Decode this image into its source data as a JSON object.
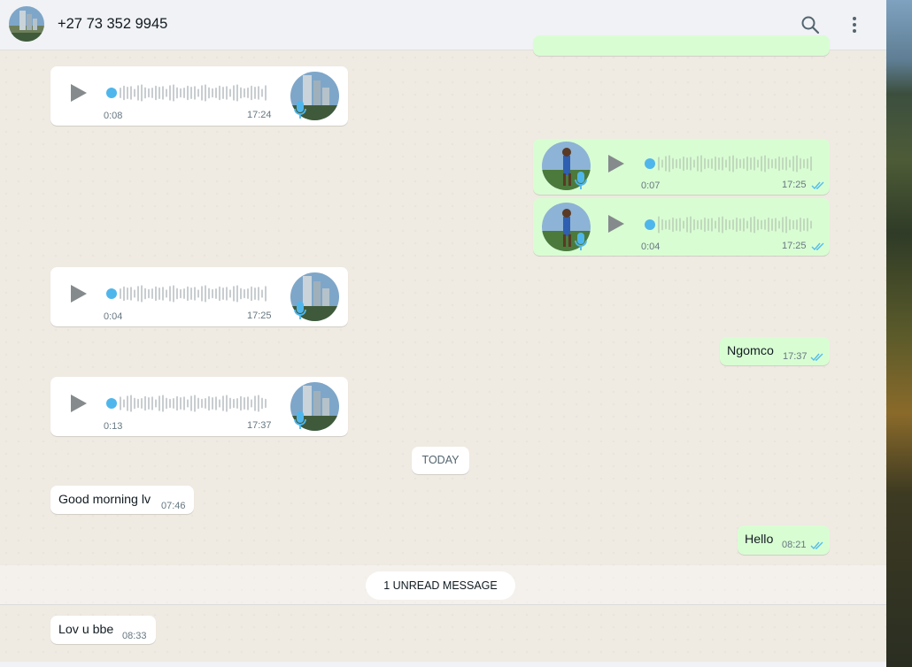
{
  "header": {
    "contact_name": "+27 73 352 9945",
    "icons": [
      "avatar",
      "search-icon",
      "menu-icon"
    ]
  },
  "messages": [
    {
      "type": "voice",
      "direction": "in",
      "duration": "0:08",
      "time": "17:24"
    },
    {
      "type": "voice",
      "direction": "out",
      "duration": "0:07",
      "time": "17:25",
      "status": "read"
    },
    {
      "type": "voice",
      "direction": "out",
      "duration": "0:04",
      "time": "17:25",
      "status": "read"
    },
    {
      "type": "voice",
      "direction": "in",
      "duration": "0:04",
      "time": "17:25"
    },
    {
      "type": "text",
      "direction": "out",
      "text": "Ngomco",
      "time": "17:37",
      "status": "read"
    },
    {
      "type": "voice",
      "direction": "in",
      "duration": "0:13",
      "time": "17:37"
    },
    {
      "type": "text",
      "direction": "in",
      "text": "Good morning lv",
      "time": "07:46"
    },
    {
      "type": "text",
      "direction": "out",
      "text": "Hello",
      "time": "08:21",
      "status": "read"
    },
    {
      "type": "text",
      "direction": "in",
      "text": "Lov u bbe",
      "time": "08:33"
    }
  ],
  "day_divider": "TODAY",
  "unread_divider": "1 UNREAD MESSAGE",
  "colors": {
    "incoming": "#ffffff",
    "outgoing": "#d9fdd3",
    "read_ticks": "#53bdeb",
    "chat_background": "#efeae2"
  }
}
